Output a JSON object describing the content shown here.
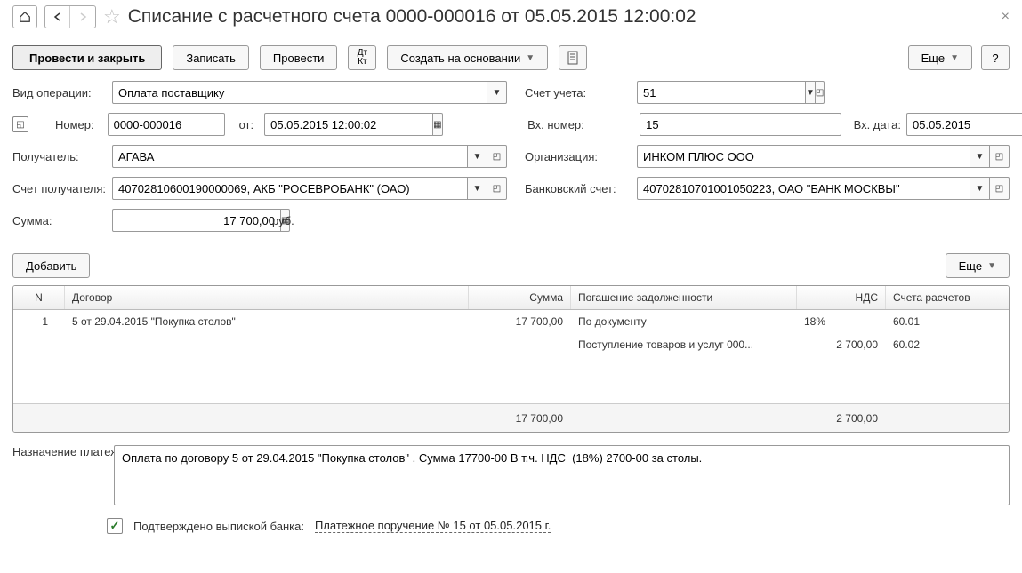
{
  "header": {
    "title": "Списание с расчетного счета 0000-000016 от 05.05.2015 12:00:02"
  },
  "toolbar": {
    "save_close": "Провести и закрыть",
    "save": "Записать",
    "post": "Провести",
    "create_base": "Создать на основании",
    "more": "Еще",
    "help": "?"
  },
  "labels": {
    "operation_type": "Вид операции:",
    "account": "Счет учета:",
    "number": "Номер:",
    "from": "от:",
    "in_number": "Вх. номер:",
    "in_date": "Вх. дата:",
    "recipient": "Получатель:",
    "organization": "Организация:",
    "recipient_account": "Счет получателя:",
    "bank_account": "Банковский счет:",
    "amount": "Сумма:",
    "currency": "руб.",
    "add": "Добавить",
    "purpose": "Назначение платежа:",
    "confirmed": "Подтверждено выпиской банка:"
  },
  "fields": {
    "operation_type": "Оплата поставщику",
    "account": "51",
    "number": "0000-000016",
    "date": "05.05.2015 12:00:02",
    "in_number": "15",
    "in_date": "05.05.2015",
    "recipient": "АГАВА",
    "organization": "ИНКОМ ПЛЮС ООО",
    "recipient_account": "40702810600190000069, АКБ \"РОСЕВРОБАНК\" (ОАО)",
    "bank_account": "40702810701001050223, ОАО \"БАНК МОСКВЫ\"",
    "amount": "17 700,00",
    "purpose": "Оплата по договору 5 от 29.04.2015 \"Покупка столов\" . Сумма 17700-00 В т.ч. НДС  (18%) 2700-00 за столы.",
    "bank_link": "Платежное поручение № 15 от 05.05.2015 г."
  },
  "table": {
    "headers": {
      "n": "N",
      "contract": "Договор",
      "sum": "Сумма",
      "debt": "Погашение задолженности",
      "vat": "НДС",
      "accounts": "Счета расчетов"
    },
    "row1": {
      "n": "1",
      "contract": "5 от 29.04.2015 \"Покупка столов\"",
      "sum": "17 700,00",
      "debt": "По документу",
      "vat": "18%",
      "acct": "60.01"
    },
    "row2": {
      "debt": "Поступление товаров и услуг 000...",
      "vat": "2 700,00",
      "acct": "60.02"
    },
    "footer": {
      "sum": "17 700,00",
      "vat": "2 700,00"
    }
  }
}
